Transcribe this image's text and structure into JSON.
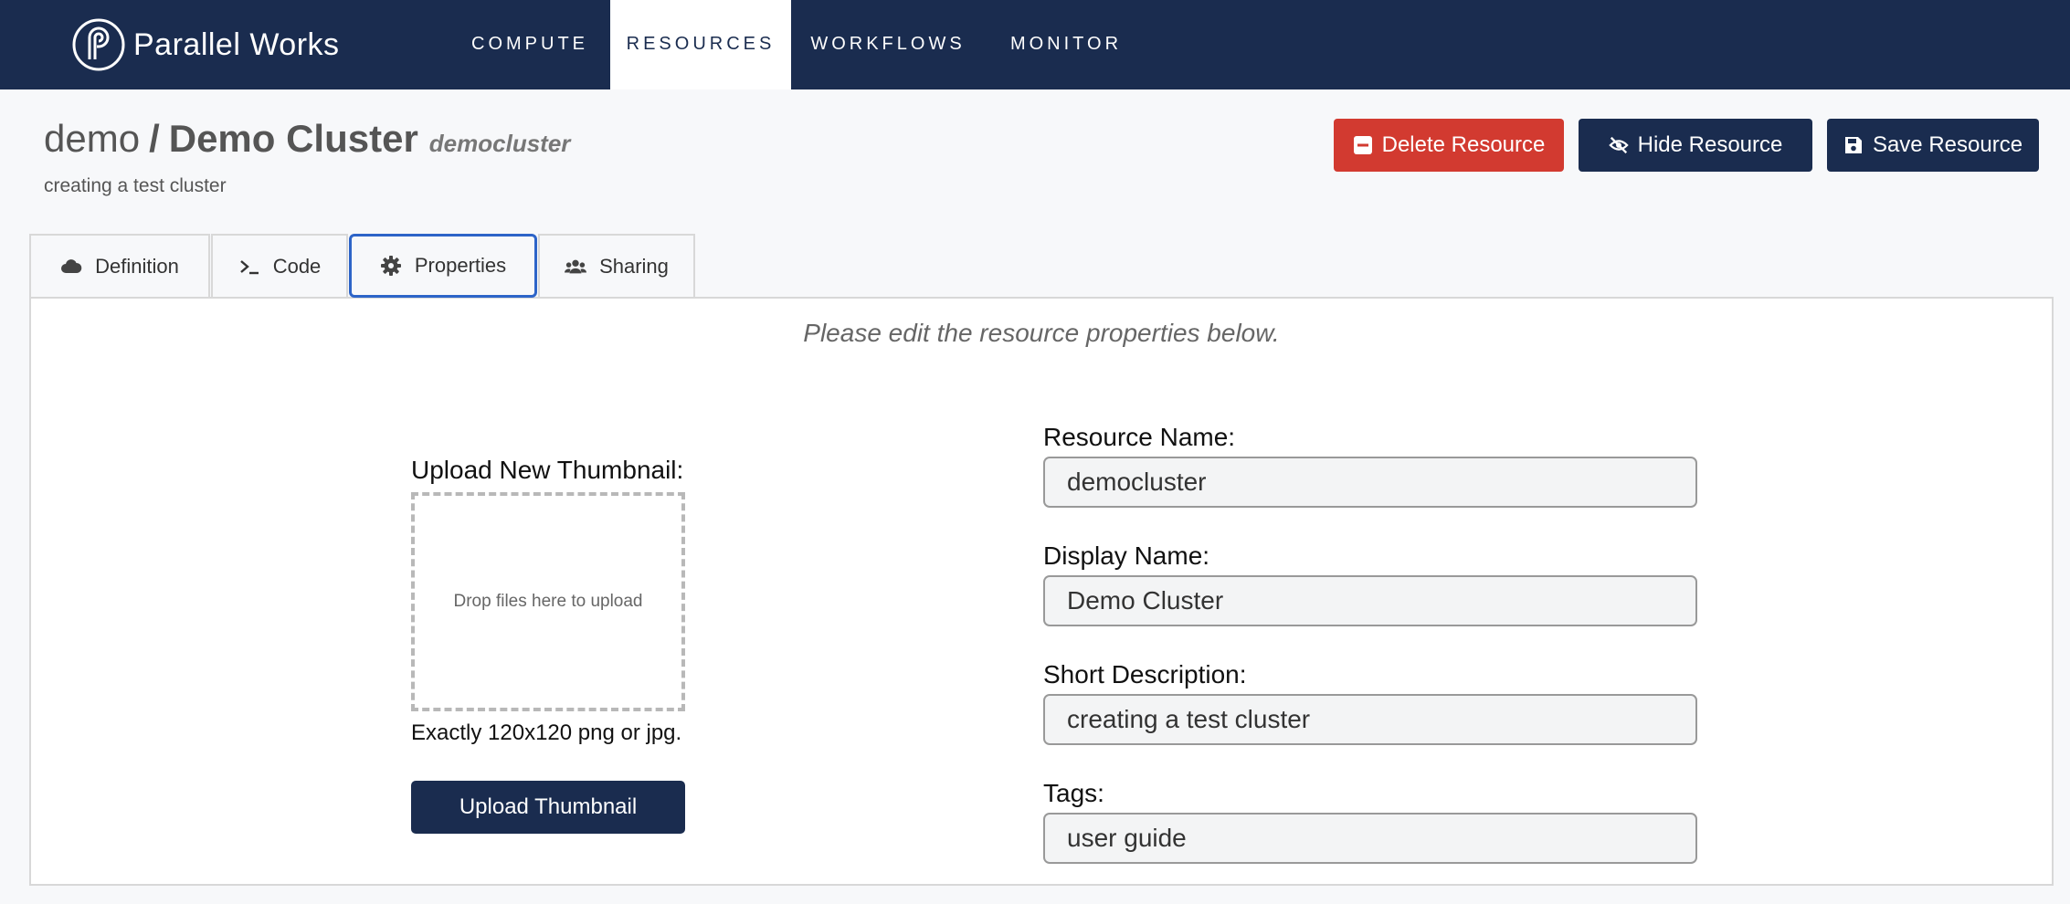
{
  "brand": {
    "name": "Parallel Works"
  },
  "nav": {
    "compute": "COMPUTE",
    "resources": "RESOURCES",
    "workflows": "WORKFLOWS",
    "monitor": "MONITOR"
  },
  "header": {
    "owner": "demo",
    "separator": "/",
    "name": "Demo Cluster",
    "slug": "democluster",
    "description": "creating a test cluster"
  },
  "actions": {
    "delete": "Delete Resource",
    "hide": "Hide Resource",
    "save": "Save Resource"
  },
  "tabs": {
    "definition": "Definition",
    "code": "Code",
    "properties": "Properties",
    "sharing": "Sharing"
  },
  "panel": {
    "hint": "Please edit the resource properties below.",
    "thumbnail": {
      "label": "Upload New Thumbnail:",
      "dropzone": "Drop files here to upload",
      "requirement": "Exactly 120x120 png or jpg.",
      "button": "Upload Thumbnail"
    },
    "fields": {
      "resource_name": {
        "label": "Resource Name:",
        "value": "democluster"
      },
      "display_name": {
        "label": "Display Name:",
        "value": "Demo Cluster"
      },
      "short_description": {
        "label": "Short Description:",
        "value": "creating a test cluster"
      },
      "tags": {
        "label": "Tags:",
        "value": "user guide"
      }
    }
  },
  "colors": {
    "navy": "#1a2c4f",
    "danger": "#d23a30",
    "active_tab_border": "#2d64c8"
  }
}
